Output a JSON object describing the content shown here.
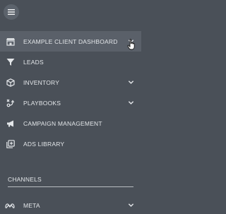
{
  "nav": {
    "items": [
      {
        "label": "EXAMPLE CLIENT DASHBOARD",
        "icon": "store-icon",
        "has_chevron": true,
        "active": true
      },
      {
        "label": "LEADS",
        "icon": "filter-icon",
        "has_chevron": false
      },
      {
        "label": "INVENTORY",
        "icon": "cube-icon",
        "has_chevron": true
      },
      {
        "label": "PLAYBOOKS",
        "icon": "strategy-icon",
        "has_chevron": true
      },
      {
        "label": "CAMPAIGN MANAGEMENT",
        "icon": "megaphone-icon",
        "has_chevron": false
      },
      {
        "label": "ADS LIBRARY",
        "icon": "library-icon",
        "has_chevron": false
      }
    ]
  },
  "channels": {
    "header": "CHANNELS",
    "items": [
      {
        "label": "META",
        "icon": "meta-icon",
        "has_chevron": true
      }
    ]
  },
  "colors": {
    "background": "#4a5058",
    "active_row": "#5a6069",
    "text": "#e3e6e9"
  }
}
